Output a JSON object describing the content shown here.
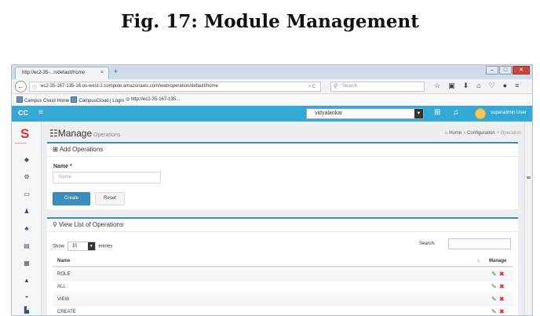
{
  "figure": {
    "title": "Fig. 17: Module Management"
  },
  "browser": {
    "tab_title": "http://ec2-35-...n/default/home",
    "tab_close": "×",
    "new_tab": "+",
    "url": "ec2-35-167-135-16.us-west-2.compute.amazonaws.com/web/operation/default/home",
    "search_placeholder": "Search",
    "bookmarks": [
      "Campus Cloud Home",
      "CampusCloud | Login",
      "http://ec2-35-167-135..."
    ]
  },
  "app": {
    "logo_text": "CC",
    "org_select": "vidyalankar",
    "user_name": "superadmin User"
  },
  "page": {
    "title": "Manage",
    "subtitle": "Operations",
    "breadcrumb": [
      "Home",
      "Configuration",
      "Operation"
    ]
  },
  "add_form": {
    "header": "Add Operations",
    "name_label": "Name",
    "required_mark": "*",
    "name_placeholder": "Name",
    "create_label": "Create",
    "reset_label": "Reset"
  },
  "list": {
    "header": "View List of Operations",
    "show_label": "Show",
    "page_length": "10",
    "entries_label": "entries",
    "search_label": "Search:",
    "columns": [
      "Name",
      "Manage"
    ],
    "rows": [
      {
        "name": "ROLE"
      },
      {
        "name": "ALL"
      },
      {
        "name": "VIEW"
      },
      {
        "name": "CREATE"
      }
    ]
  },
  "colors": {
    "appbar": "#35a9d5",
    "primary": "#3c8dbc",
    "delete": "#dd2222",
    "edit": "#3a7d3a"
  },
  "icons": {
    "sidebar": [
      "dashboard-icon",
      "settings-icon",
      "calendar-icon",
      "user-add-icon",
      "users-icon",
      "list-icon",
      "grid-icon",
      "person-icon",
      "chat-icon",
      "building-icon",
      "chart-icon"
    ]
  }
}
